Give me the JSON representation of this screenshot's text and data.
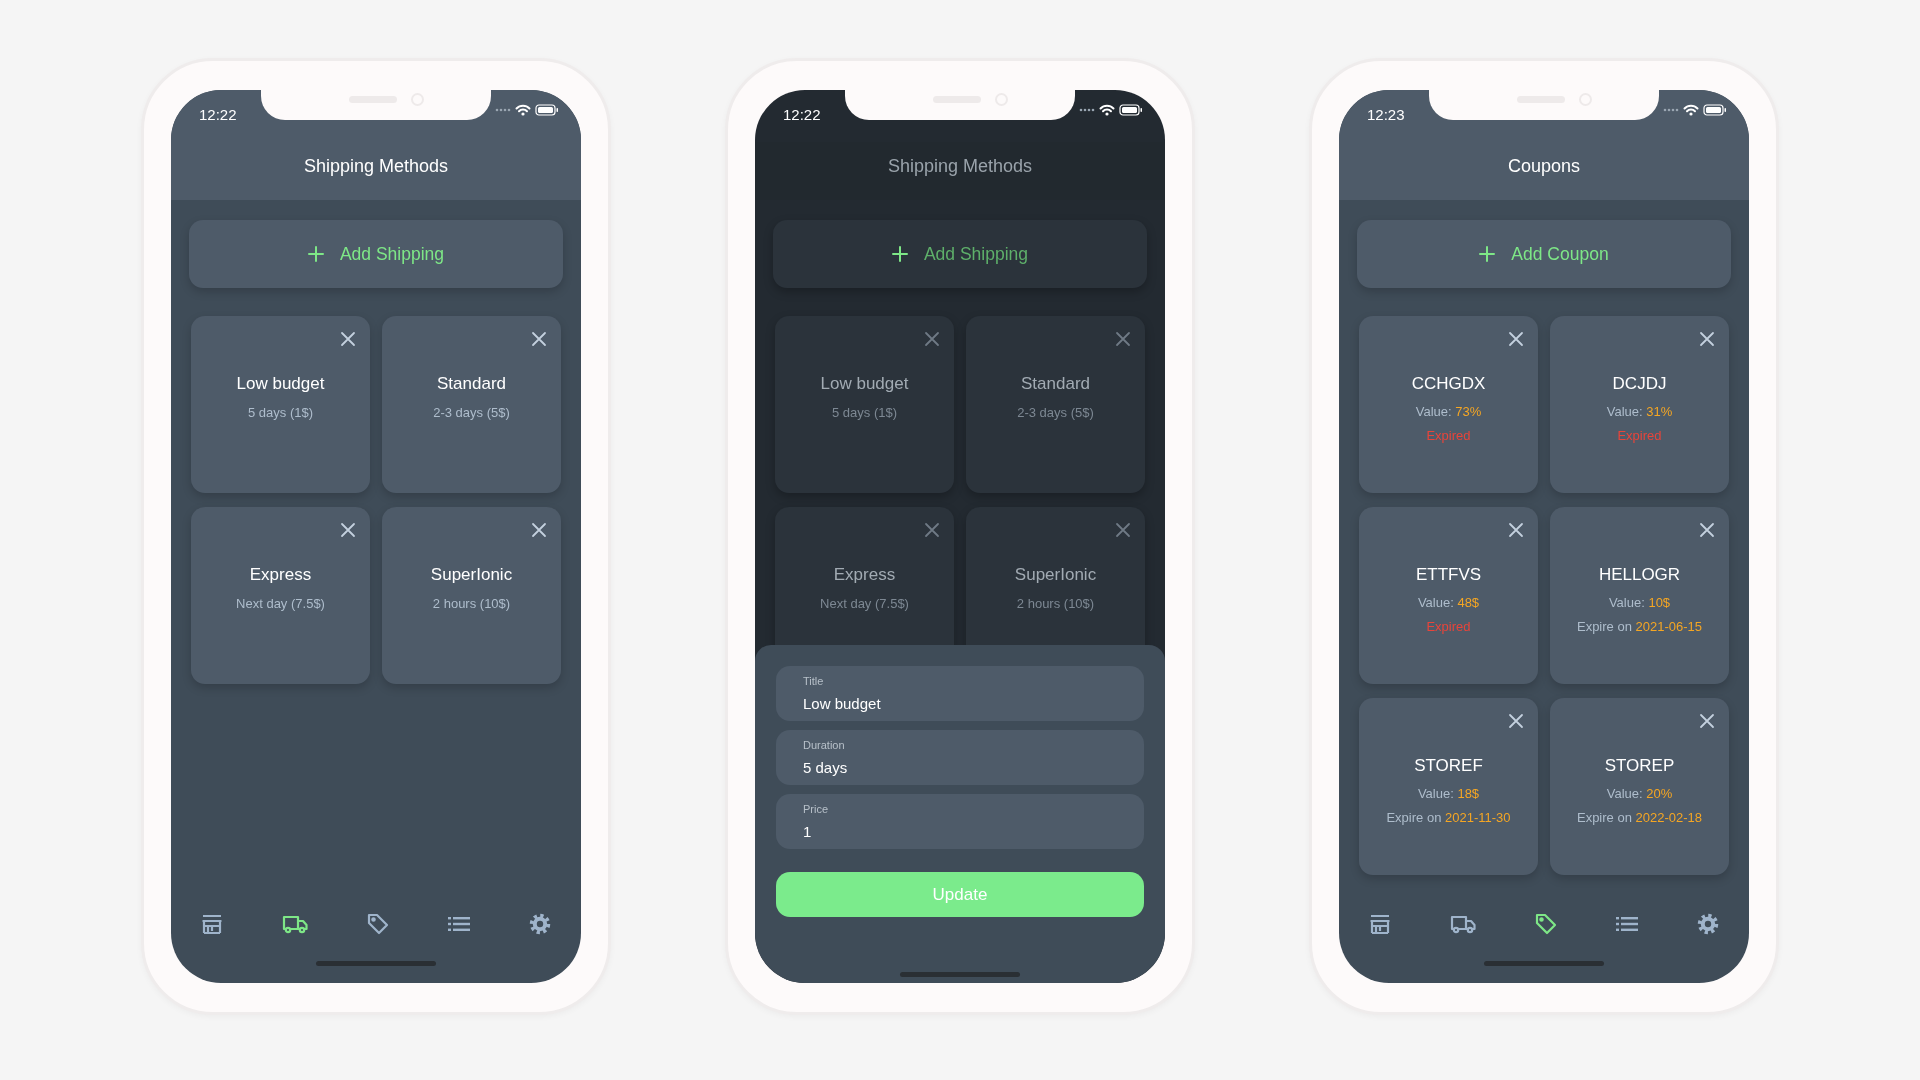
{
  "phones": [
    {
      "kind": "shipping",
      "dimmed": false,
      "status_time": "12:22",
      "title": "Shipping Methods",
      "add_button": "Add Shipping",
      "items": [
        {
          "title": "Low budget",
          "subtitle": "5 days (1$)"
        },
        {
          "title": "Standard",
          "subtitle": "2-3 days (5$)"
        },
        {
          "title": "Express",
          "subtitle": "Next day (7.5$)"
        },
        {
          "title": "SuperIonic",
          "subtitle": "2 hours (10$)"
        }
      ],
      "tabs": [
        {
          "selected": false
        },
        {
          "selected": true
        },
        {
          "selected": false
        },
        {
          "selected": false
        },
        {
          "selected": false
        }
      ]
    },
    {
      "kind": "shipping",
      "dimmed": true,
      "status_time": "12:22",
      "title": "Shipping Methods",
      "add_button": "Add Shipping",
      "items": [
        {
          "title": "Low budget",
          "subtitle": "5 days (1$)"
        },
        {
          "title": "Standard",
          "subtitle": "2-3 days (5$)"
        },
        {
          "title": "Express",
          "subtitle": "Next day (7.5$)"
        },
        {
          "title": "SuperIonic",
          "subtitle": "2 hours (10$)"
        }
      ],
      "sheet": {
        "fields": [
          {
            "label": "Title",
            "value": "Low budget"
          },
          {
            "label": "Duration",
            "value": "5 days"
          },
          {
            "label": "Price",
            "value": "1"
          }
        ],
        "button": "Update"
      }
    },
    {
      "kind": "coupons",
      "dimmed": false,
      "status_time": "12:23",
      "title": "Coupons",
      "add_button": "Add Coupon",
      "items": [
        {
          "title": "CCHGDX",
          "value_label": "Value:",
          "value": "73%",
          "expiry": {
            "kind": "expired",
            "text": "Expired"
          }
        },
        {
          "title": "DCJDJ",
          "value_label": "Value:",
          "value": "31%",
          "expiry": {
            "kind": "expired",
            "text": "Expired"
          }
        },
        {
          "title": "ETTFVS",
          "value_label": "Value:",
          "value": "48$",
          "expiry": {
            "kind": "expired",
            "text": "Expired"
          }
        },
        {
          "title": "HELLOGR",
          "value_label": "Value:",
          "value": "10$",
          "expiry": {
            "kind": "date",
            "label": "Expire on",
            "date": "2021-06-15"
          }
        },
        {
          "title": "STOREF",
          "value_label": "Value:",
          "value": "18$",
          "expiry": {
            "kind": "date",
            "label": "Expire on",
            "date": "2021-11-30"
          }
        },
        {
          "title": "STOREP",
          "value_label": "Value:",
          "value": "20%",
          "expiry": {
            "kind": "date",
            "label": "Expire on",
            "date": "2022-02-18"
          }
        }
      ],
      "tabs": [
        {
          "selected": false
        },
        {
          "selected": false
        },
        {
          "selected": true
        },
        {
          "selected": false
        },
        {
          "selected": false
        }
      ]
    }
  ]
}
